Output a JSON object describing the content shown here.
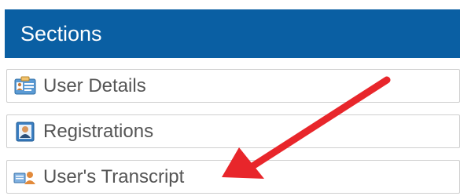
{
  "panel": {
    "title": "Sections"
  },
  "sections": {
    "items": [
      {
        "label": "User Details",
        "icon": "user-details-card-icon"
      },
      {
        "label": "Registrations",
        "icon": "registrations-user-icon"
      },
      {
        "label": "User's Transcript",
        "icon": "transcript-icon"
      }
    ]
  },
  "colors": {
    "header_bg": "#0a5fa3",
    "header_text": "#ffffff",
    "item_text": "#555555",
    "annotation_arrow": "#e8262b"
  }
}
